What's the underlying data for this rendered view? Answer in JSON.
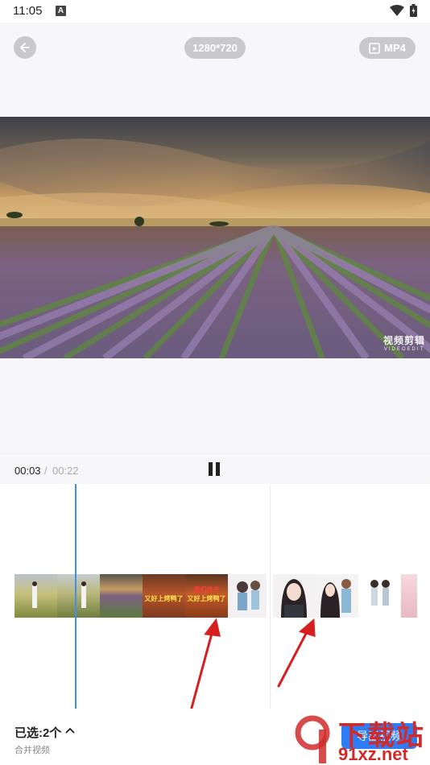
{
  "status_bar": {
    "time": "11:05",
    "notification_letter": "A"
  },
  "header": {
    "resolution": "1280*720",
    "format": "MP4"
  },
  "preview": {
    "watermark_cn": "视频剪辑",
    "watermark_en": "VIDEOEDIT"
  },
  "player": {
    "current_time": "00:03",
    "separator": "/",
    "total_time": "00:22"
  },
  "timeline": {
    "clips": [
      {
        "name": "lavender-clip-1",
        "caption_top": "",
        "caption": ""
      },
      {
        "name": "lavender-clip-2",
        "caption_top": "",
        "caption": ""
      },
      {
        "name": "lavender-clip-3",
        "caption_top": "",
        "caption": ""
      },
      {
        "name": "food-clip-1",
        "caption_top": "",
        "caption": "又好上烤鸭了"
      },
      {
        "name": "food-clip-2",
        "caption_top": "我们终于",
        "caption": "又好上烤鸭了"
      },
      {
        "name": "anime-clip-1",
        "caption_top": "",
        "caption": ""
      },
      {
        "name": "anime-clip-2",
        "caption_top": "",
        "caption": ""
      },
      {
        "name": "anime-clip-3",
        "caption_top": "",
        "caption": ""
      },
      {
        "name": "anime-clip-4",
        "caption_top": "",
        "caption": ""
      },
      {
        "name": "anime-clip-5",
        "caption_top": "",
        "caption": ""
      }
    ]
  },
  "footer": {
    "selected": "已选:2个",
    "merge_label": "合并视频",
    "export_label": "导出视频"
  },
  "site_watermark": {
    "logo": "下载站",
    "url": "91xz.net"
  },
  "colors": {
    "accent": "#2f7df6",
    "playhead": "#3f8ff0",
    "arrow": "#d61f1f"
  }
}
